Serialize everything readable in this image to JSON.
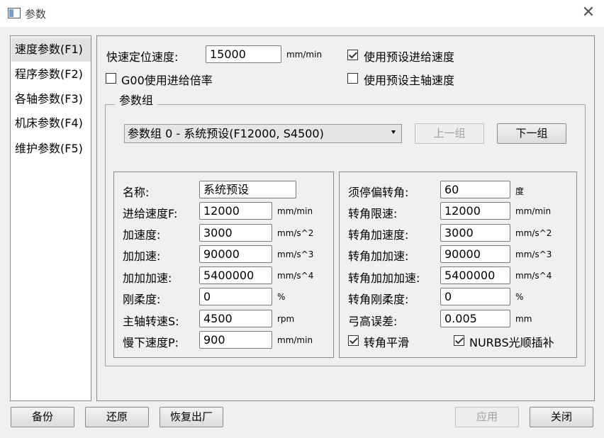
{
  "window": {
    "title": "参数",
    "close_glyph": "✕"
  },
  "sidebar": {
    "items": [
      {
        "label": "速度参数(F1)",
        "active": true
      },
      {
        "label": "程序参数(F2)"
      },
      {
        "label": "各轴参数(F3)"
      },
      {
        "label": "机床参数(F4)"
      },
      {
        "label": "维护参数(F5)"
      }
    ]
  },
  "top": {
    "rapid_label": "快速定位速度:",
    "rapid_value": "15000",
    "rapid_unit": "mm/min",
    "use_preset_feed_label": "使用预设进给速度",
    "use_preset_feed_checked": true,
    "g00_label": "G00使用进给倍率",
    "g00_checked": false,
    "use_preset_spindle_label": "使用预设主轴速度",
    "use_preset_spindle_checked": false
  },
  "group": {
    "title": "参数组",
    "selected": "参数组 0 - 系统预设(F12000, S4500)",
    "prev_label": "上一组",
    "next_label": "下一组"
  },
  "left_params": [
    {
      "label": "名称:",
      "value": "系统预设",
      "unit": ""
    },
    {
      "label": "进给速度F:",
      "value": "12000",
      "unit": "mm/min"
    },
    {
      "label": "加速度:",
      "value": "3000",
      "unit": "mm/s^2"
    },
    {
      "label": "加加速:",
      "value": "90000",
      "unit": "mm/s^3"
    },
    {
      "label": "加加加速:",
      "value": "5400000",
      "unit": "mm/s^4"
    },
    {
      "label": "刚柔度:",
      "value": "0",
      "unit": "%"
    },
    {
      "label": "主轴转速S:",
      "value": "4500",
      "unit": "rpm"
    },
    {
      "label": "慢下速度P:",
      "value": "900",
      "unit": "mm/min"
    }
  ],
  "right_params": [
    {
      "label": "须停偏转角:",
      "value": "60",
      "unit": "度"
    },
    {
      "label": "转角限速:",
      "value": "12000",
      "unit": "mm/min"
    },
    {
      "label": "转角加速度:",
      "value": "3000",
      "unit": "mm/s^2"
    },
    {
      "label": "转角加加速:",
      "value": "90000",
      "unit": "mm/s^3"
    },
    {
      "label": "转角加加加速:",
      "value": "5400000",
      "unit": "mm/s^4"
    },
    {
      "label": "转角刚柔度:",
      "value": "0",
      "unit": "%"
    },
    {
      "label": "弓高误差:",
      "value": "0.005",
      "unit": "mm"
    }
  ],
  "right_checks": {
    "corner_smooth_label": "转角平滑",
    "corner_smooth_checked": true,
    "nurbs_label": "NURBS光顺插补",
    "nurbs_checked": true
  },
  "footer": {
    "backup": "备份",
    "restore": "还原",
    "factory": "恢复出厂",
    "apply": "应用",
    "close": "关闭"
  }
}
